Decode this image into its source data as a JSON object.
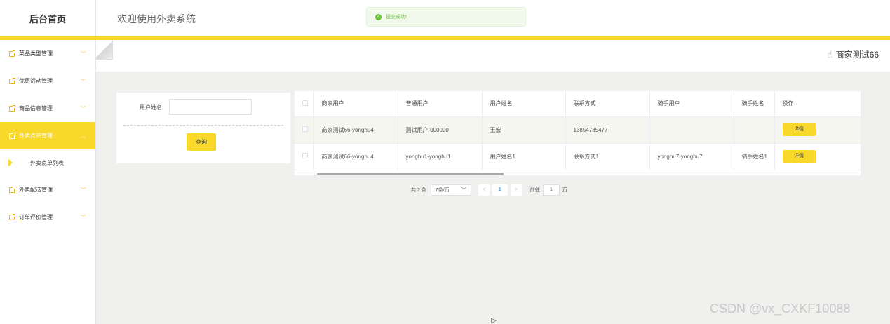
{
  "header": {
    "logo": "后台首页",
    "title": "欢迎使用外卖系统",
    "toast": "提交成功!"
  },
  "sidebar": {
    "items": [
      {
        "label": "菜品类型管理",
        "arrow": "﹀"
      },
      {
        "label": "优惠活动管理",
        "arrow": "﹀"
      },
      {
        "label": "商品信息管理",
        "arrow": "﹀"
      },
      {
        "label": "外卖点单管理",
        "arrow": "︿"
      },
      {
        "label": "外卖点单列表"
      },
      {
        "label": "外卖配送管理",
        "arrow": "﹀"
      },
      {
        "label": "订单评价管理",
        "arrow": "﹀"
      }
    ]
  },
  "topbar": {
    "user": "商家测试66"
  },
  "search": {
    "label": "用户姓名",
    "value": "",
    "button": "查询"
  },
  "table": {
    "headers": [
      "商家用户",
      "普通用户",
      "用户姓名",
      "联系方式",
      "骑手用户",
      "骑手姓名",
      "操作"
    ],
    "rows": [
      [
        "商家测试66-yonghu4",
        "测试用户-000000",
        "王宏",
        "13854785477",
        "",
        "",
        "详情"
      ],
      [
        "商家测试66-yonghu4",
        "yonghu1-yonghu1",
        "用户姓名1",
        "联系方式1",
        "yonghu7-yonghu7",
        "骑手姓名1",
        "详情"
      ]
    ]
  },
  "pagination": {
    "total": "共 2 条",
    "page_size": "7条/页",
    "prev": "<",
    "current": "1",
    "next": ">",
    "goto_label": "前往",
    "goto_value": "1",
    "page_unit": "页"
  },
  "watermark": "CSDN @vx_CXKF10088",
  "colors": {
    "accent": "#f7d82b",
    "success": "#67c23a"
  },
  "icons": {
    "toast": "check-circle-icon",
    "menu": "document-icon",
    "user": "user-hand-icon"
  }
}
